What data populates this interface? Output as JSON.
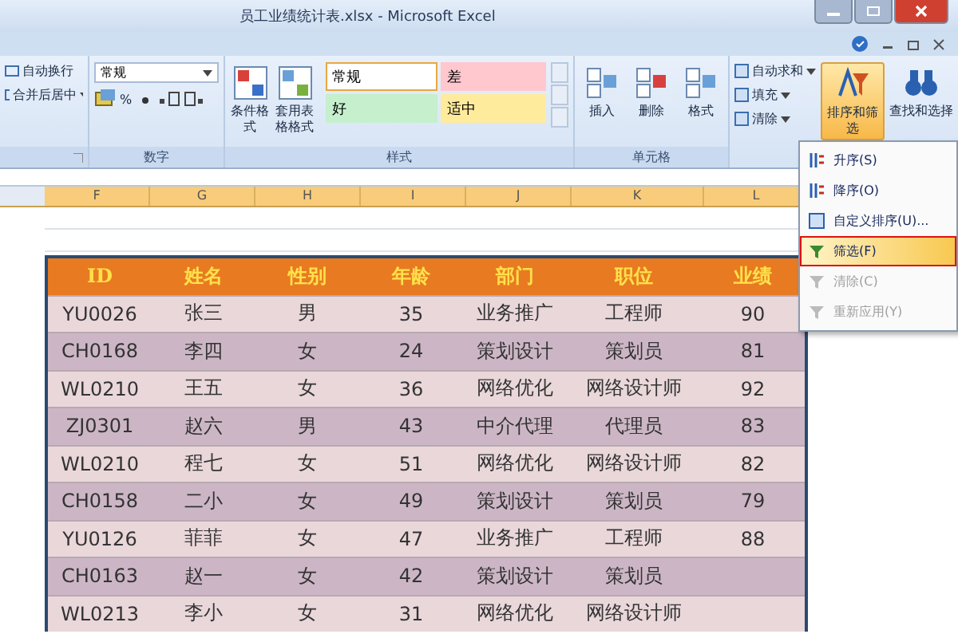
{
  "window": {
    "title": "员工业绩统计表.xlsx - Microsoft Excel"
  },
  "alignment": {
    "buttons": [
      "自动换行",
      "合并后居中"
    ]
  },
  "number": {
    "format": "常规",
    "percent": "%",
    "label": "数字"
  },
  "styles": {
    "label": "样式",
    "buttons": [
      "条件格式",
      "套用表格格式"
    ],
    "cell_styles": [
      {
        "text": "常规",
        "color": "#ffffff",
        "selected": true
      },
      {
        "text": "差",
        "color": "#ffc7ce",
        "selected": false
      },
      {
        "text": "好",
        "color": "#c6efce",
        "selected": false
      },
      {
        "text": "适中",
        "color": "#ffeb9c",
        "selected": false
      }
    ]
  },
  "cells": {
    "label": "单元格",
    "buttons": [
      "插入",
      "删除",
      "格式"
    ]
  },
  "editing": {
    "small": [
      "自动求和",
      "填充",
      "清除"
    ],
    "sort": {
      "label": "排序和筛选",
      "selected": true
    },
    "find": "查找和选择"
  },
  "menu": {
    "items": [
      {
        "text": "升序(S)",
        "selected": false,
        "disabled": false
      },
      {
        "text": "降序(O)",
        "selected": false,
        "disabled": false
      },
      {
        "text": "自定义排序(U)...",
        "selected": false,
        "disabled": false
      },
      {
        "text": "筛选(F)",
        "selected": true,
        "disabled": false
      },
      {
        "text": "清除(C)",
        "selected": false,
        "disabled": true
      },
      {
        "text": "重新应用(Y)",
        "selected": false,
        "disabled": true
      }
    ]
  },
  "sheet": {
    "columns": [
      "F",
      "G",
      "H",
      "I",
      "J",
      "K",
      "L"
    ],
    "table": {
      "header": [
        "ID",
        "姓名",
        "性别",
        "年龄",
        "部门",
        "职位",
        "业绩"
      ],
      "rows": [
        [
          "YU0026",
          "张三",
          "男",
          "35",
          "业务推广",
          "工程师",
          "90"
        ],
        [
          "CH0168",
          "李四",
          "女",
          "24",
          "策划设计",
          "策划员",
          "81"
        ],
        [
          "WL0210",
          "王五",
          "女",
          "36",
          "网络优化",
          "网络设计师",
          "92"
        ],
        [
          "ZJ0301",
          "赵六",
          "男",
          "43",
          "中介代理",
          "代理员",
          "83"
        ],
        [
          "WL0210",
          "程七",
          "女",
          "51",
          "网络优化",
          "网络设计师",
          "82"
        ],
        [
          "CH0158",
          "二小",
          "女",
          "49",
          "策划设计",
          "策划员",
          "79"
        ],
        [
          "YU0126",
          "菲菲",
          "女",
          "47",
          "业务推广",
          "工程师",
          "88"
        ],
        [
          "CH0163",
          "赵一",
          "女",
          "42",
          "策划设计",
          "策划员",
          ""
        ],
        [
          "WL0213",
          "李小",
          "女",
          "31",
          "网络优化",
          "网络设计师",
          ""
        ]
      ]
    }
  }
}
